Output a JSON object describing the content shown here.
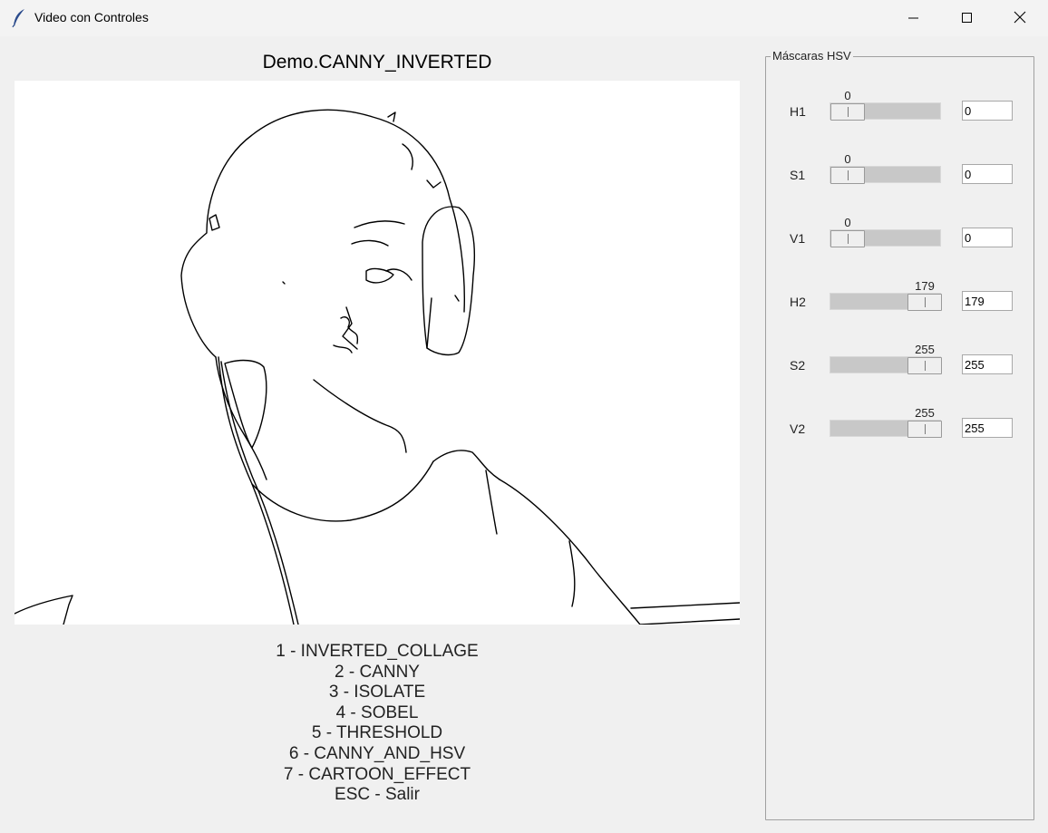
{
  "window": {
    "title": "Video con Controles",
    "icon": "feather-icon"
  },
  "demo_title": "Demo.CANNY_INVERTED",
  "menu_items": [
    "1 - INVERTED_COLLAGE",
    "2 - CANNY",
    "3 - ISOLATE",
    "4 - SOBEL",
    "5 - THRESHOLD",
    "6 - CANNY_AND_HSV",
    "7 - CARTOON_EFFECT",
    "ESC - Salir"
  ],
  "hsv_panel": {
    "title": "Máscaras HSV",
    "sliders": [
      {
        "label": "H1",
        "value": "0",
        "entry": "0",
        "min": 0,
        "max": 179
      },
      {
        "label": "S1",
        "value": "0",
        "entry": "0",
        "min": 0,
        "max": 255
      },
      {
        "label": "V1",
        "value": "0",
        "entry": "0",
        "min": 0,
        "max": 255
      },
      {
        "label": "H2",
        "value": "179",
        "entry": "179",
        "min": 0,
        "max": 179
      },
      {
        "label": "S2",
        "value": "255",
        "entry": "255",
        "min": 0,
        "max": 255
      },
      {
        "label": "V2",
        "value": "255",
        "entry": "255",
        "min": 0,
        "max": 255
      }
    ]
  }
}
